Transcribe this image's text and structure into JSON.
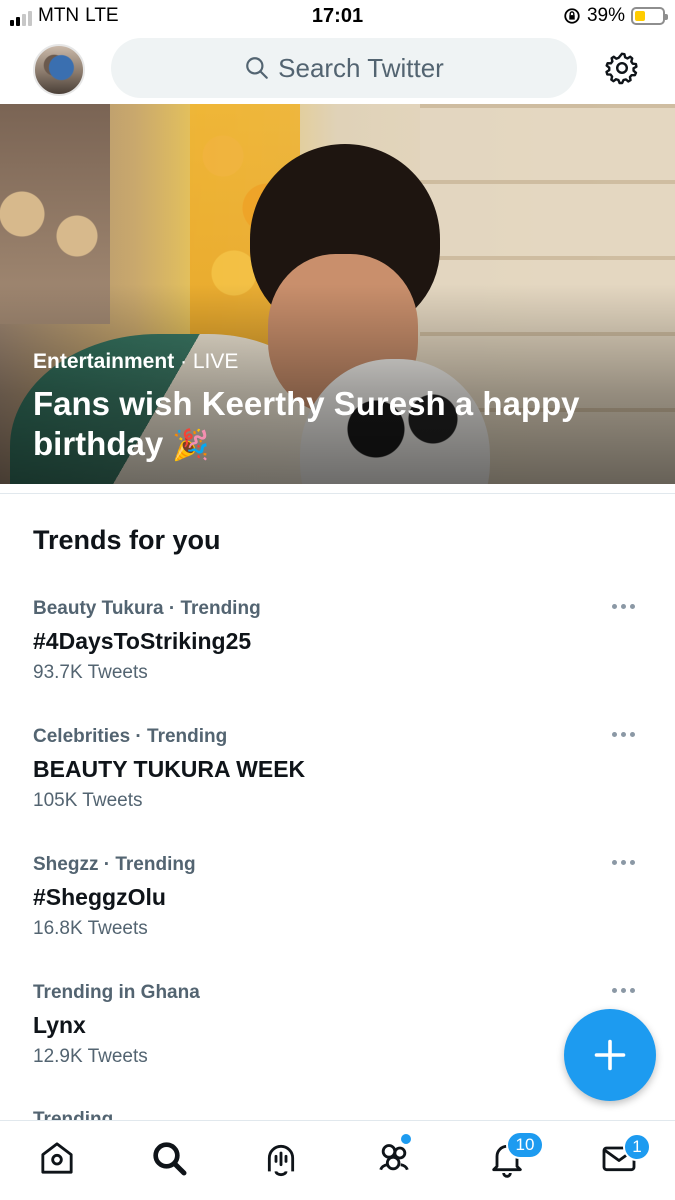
{
  "status_bar": {
    "carrier": "MTN",
    "network": "LTE",
    "time": "17:01",
    "battery_percent": "39%",
    "battery_level": 0.39,
    "signal_bars": 2,
    "signal_max": 4
  },
  "header": {
    "search_placeholder": "Search Twitter",
    "avatar_icon": "profile-avatar",
    "settings_icon": "gear-icon"
  },
  "hero": {
    "category": "Entertainment",
    "separator": " · ",
    "status": "LIVE",
    "title": "Fans wish Keerthy Suresh a happy birthday",
    "title_emoji": "🎉"
  },
  "trends": {
    "heading": "Trends for you",
    "items": [
      {
        "context": "Beauty Tukura · Trending",
        "name": "#4DaysToStriking25",
        "count": "93.7K Tweets"
      },
      {
        "context": "Celebrities · Trending",
        "name": "BEAUTY TUKURA WEEK",
        "count": "105K Tweets"
      },
      {
        "context": "Shegzz · Trending",
        "name": "#SheggzOlu",
        "count": "16.8K Tweets"
      },
      {
        "context": "Trending in Ghana",
        "name": "Lynx",
        "count": "12.9K Tweets"
      }
    ],
    "partial_next": "Trending"
  },
  "fab": {
    "icon": "plus-icon"
  },
  "tab_bar": {
    "tabs": [
      "home-icon",
      "search-icon",
      "spaces-icon",
      "communities-icon",
      "notifications-icon",
      "messages-icon"
    ],
    "notifications_badge": "10",
    "messages_badge": "1"
  },
  "colors": {
    "accent": "#1d9bf0",
    "text_primary": "#0f1419",
    "text_secondary": "#536471",
    "search_bg": "#eff3f4"
  }
}
